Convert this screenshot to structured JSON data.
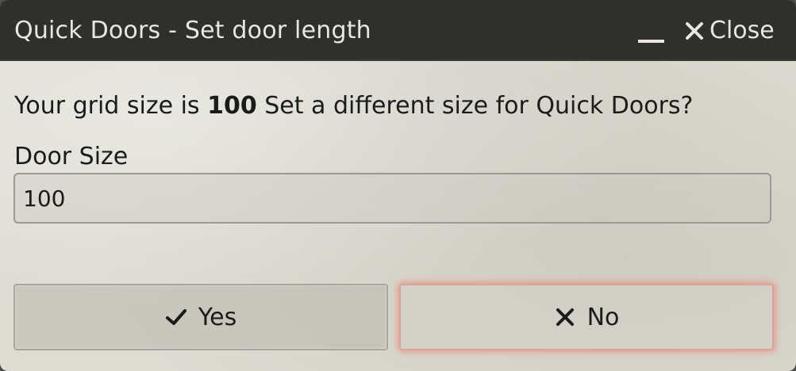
{
  "dialog": {
    "title": "Quick Doors - Set door length",
    "close_label": "Close",
    "message_prefix": "Your grid size is ",
    "grid_size": "100",
    "message_suffix": " Set a different size for Quick Doors?",
    "field_label": "Door Size",
    "door_size_value": "100",
    "yes_label": "Yes",
    "no_label": "No"
  },
  "icons": {
    "minimize": "minimize-icon",
    "close": "close-icon",
    "yes": "check-icon",
    "no": "x-icon"
  },
  "colors": {
    "titlebar": "#2f2f2c",
    "focus_glow": "#ff503c"
  }
}
